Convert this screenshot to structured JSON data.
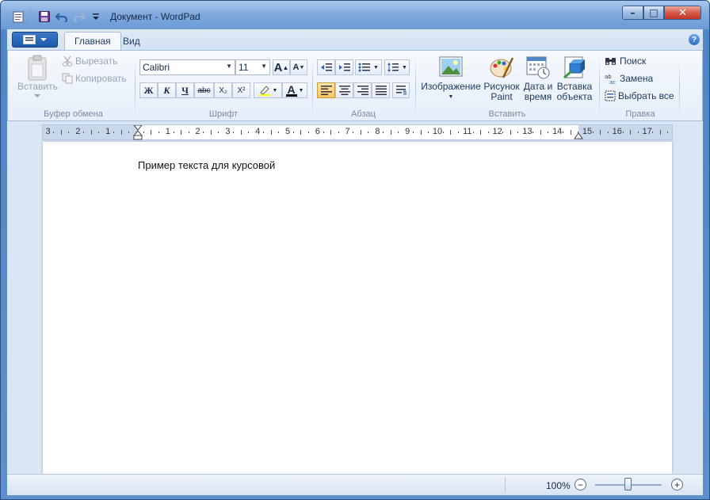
{
  "window": {
    "title": "Документ - WordPad"
  },
  "titlebar": {
    "minimize": "–",
    "maximize": "□",
    "close": "✕"
  },
  "tabs": [
    {
      "label": "Главная",
      "active": true
    },
    {
      "label": "Вид",
      "active": false
    }
  ],
  "ribbon": {
    "clipboard": {
      "label": "Буфер обмена",
      "paste": "Вставить",
      "cut": "Вырезать",
      "copy": "Копировать"
    },
    "font": {
      "label": "Шрифт",
      "family": "Calibri",
      "size": "11",
      "bold": "Ж",
      "italic": "К",
      "underline": "Ч",
      "strike": "abc",
      "subscript": "X₂",
      "superscript": "X²",
      "color_letter": "A"
    },
    "paragraph": {
      "label": "Абзац"
    },
    "insert": {
      "label": "Вставить",
      "picture": "Изображение",
      "paint1": "Рисунок",
      "paint2": "Paint",
      "date1": "Дата и",
      "date2": "время",
      "object1": "Вставка",
      "object2": "объекта"
    },
    "editing": {
      "label": "Правка",
      "find": "Поиск",
      "replace": "Замена",
      "select_all": "Выбрать все"
    }
  },
  "ruler": {
    "numbers": [
      "3",
      "2",
      "1",
      "1",
      "2",
      "3",
      "4",
      "5",
      "6",
      "7",
      "8",
      "9",
      "10",
      "11",
      "12",
      "13",
      "14",
      "15",
      "16",
      "17"
    ]
  },
  "document": {
    "text": "Пример текста для курсовой"
  },
  "status": {
    "zoom": "100%",
    "zoom_fraction": 0.5
  },
  "colors": {
    "accent": "#4f86c6",
    "selected": "#f8c45b"
  }
}
